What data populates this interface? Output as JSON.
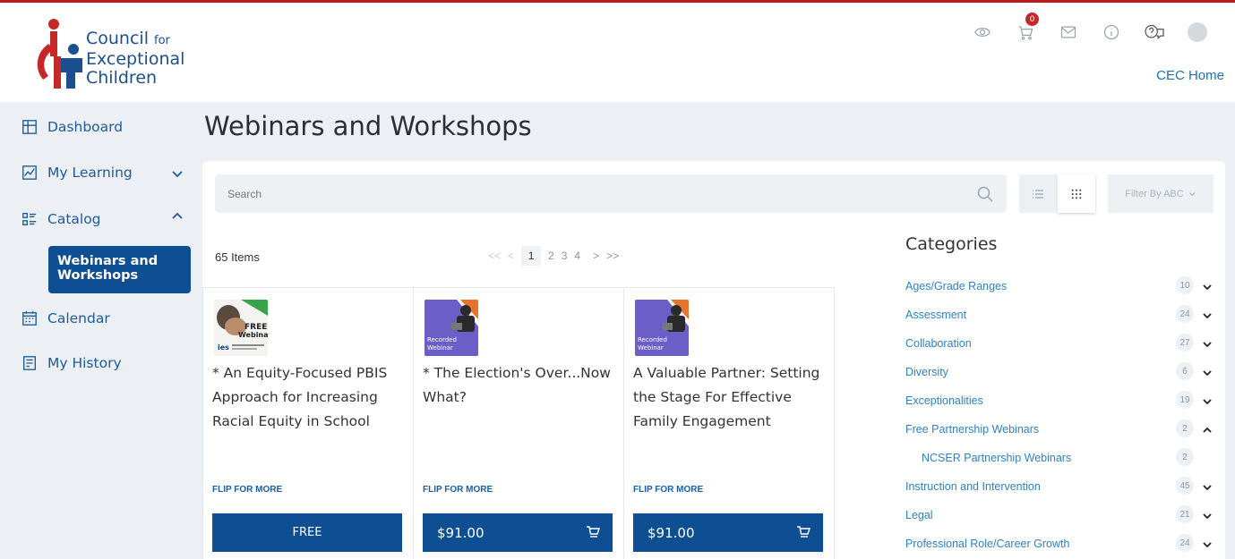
{
  "brand": {
    "line1": "Council",
    "line1_small": "for",
    "line2": "Exceptional",
    "line3": "Children",
    "colors": {
      "red": "#c62828",
      "blue": "#1c4f91"
    }
  },
  "header": {
    "cart_count": "0",
    "cec_home": "CEC Home",
    "icons": [
      "eye-icon",
      "cart-icon",
      "mail-icon",
      "info-icon",
      "help-icon",
      "avatar"
    ]
  },
  "sidebar": {
    "items": [
      {
        "label": "Dashboard",
        "icon": "dashboard-icon"
      },
      {
        "label": "My Learning",
        "icon": "chart-icon"
      },
      {
        "label": "Catalog",
        "icon": "catalog-icon"
      },
      {
        "label": "Calendar",
        "icon": "calendar-icon"
      },
      {
        "label": "My History",
        "icon": "history-icon"
      }
    ],
    "active_sub": "Webinars and Workshops"
  },
  "page": {
    "title": "Webinars and Workshops"
  },
  "toolbar": {
    "search_placeholder": "Search",
    "filter_label": "Filter By ABC"
  },
  "listing": {
    "count": "65 Items",
    "pager": {
      "first": "<<",
      "prev": "<",
      "pages": [
        "1",
        "2",
        "3",
        "4"
      ],
      "next": ">",
      "last": ">>"
    }
  },
  "cards": [
    {
      "title": "* An Equity-Focused PBIS Approach for Increasing Racial Equity in School",
      "flip": "FLIP FOR MORE",
      "price": "FREE",
      "thumb_text1": "FREE",
      "thumb_text2": "Webinar",
      "thumb_text3": "ies"
    },
    {
      "title": "* The Election's Over...Now What?",
      "flip": "FLIP FOR MORE",
      "price": "$91.00",
      "thumb_text1": "Recorded",
      "thumb_text2": "Webinar"
    },
    {
      "title": "A Valuable Partner: Setting the Stage For Effective Family Engagement",
      "flip": "FLIP FOR MORE",
      "price": "$91.00",
      "thumb_text1": "Recorded",
      "thumb_text2": "Webinar"
    }
  ],
  "categories": {
    "title": "Categories",
    "items": [
      {
        "label": "Ages/Grade Ranges",
        "count": "10",
        "chevron": "down"
      },
      {
        "label": "Assessment",
        "count": "24",
        "chevron": "down"
      },
      {
        "label": "Collaboration",
        "count": "27",
        "chevron": "down"
      },
      {
        "label": "Diversity",
        "count": "6",
        "chevron": "down"
      },
      {
        "label": "Exceptionalities",
        "count": "19",
        "chevron": "down"
      },
      {
        "label": "Free Partnership Webinars",
        "count": "2",
        "chevron": "up"
      },
      {
        "label": "NCSER Partnership Webinars",
        "count": "2",
        "chevron": "none"
      },
      {
        "label": "Instruction and Intervention",
        "count": "45",
        "chevron": "down"
      },
      {
        "label": "Legal",
        "count": "21",
        "chevron": "down"
      },
      {
        "label": "Professional Role/Career Growth",
        "count": "24",
        "chevron": "down"
      }
    ]
  }
}
